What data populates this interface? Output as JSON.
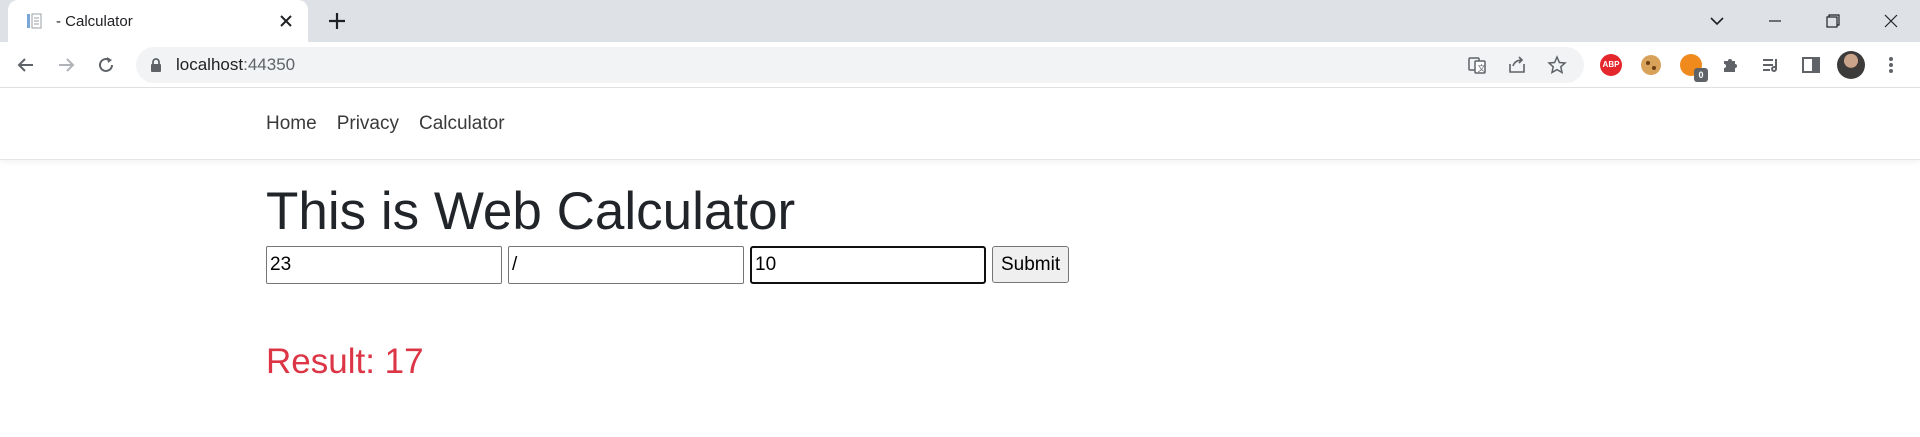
{
  "browser": {
    "tab": {
      "title": "- Calculator",
      "favicon": "document-icon"
    },
    "new_tab_label": "+",
    "url_host": "localhost",
    "url_port": ":44350",
    "extensions": {
      "abp_label": "ABP",
      "badge_count": "0"
    }
  },
  "nav": {
    "items": [
      "Home",
      "Privacy",
      "Calculator"
    ]
  },
  "page": {
    "heading": "This is Web Calculator",
    "form": {
      "operand1": "23",
      "operator": "/",
      "operand2": "10",
      "submit_label": "Submit"
    },
    "result": "Result: 17"
  },
  "colors": {
    "result": "#dc3545",
    "tabstrip": "#dee1e6",
    "omnibox": "#f1f3f4"
  }
}
